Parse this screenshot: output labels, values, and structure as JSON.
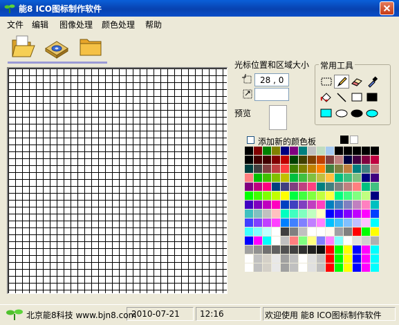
{
  "window": {
    "title": "能8 ICO图标制作软件"
  },
  "menu": [
    "文件",
    "编辑",
    "图像处理",
    "颜色处理",
    "帮助"
  ],
  "toolbar": {
    "icons": [
      "open-folder-icon",
      "disk-save-icon",
      "folder-icon"
    ]
  },
  "cursor_area": {
    "label": "光标位置和区域大小",
    "position_value": "28 , 0",
    "size_value": ""
  },
  "tools": {
    "title": "常用工具",
    "items": [
      "rect-select-icon",
      "pencil-icon",
      "eraser-icon",
      "eyedropper-icon",
      "fill-bucket-icon",
      "line-icon",
      "rectangle-outline-icon",
      "filled-rectangle-icon",
      "filled-rect-cyan-icon",
      "ellipse-outline-icon",
      "filled-ellipse-icon",
      "filled-ellipse-cyan-icon"
    ],
    "selected": "pencil-icon"
  },
  "preview": {
    "label": "预览"
  },
  "palette": {
    "add_label": "添加新的颜色板",
    "fg_color": "#000000",
    "bg_color": "#ffffff",
    "colors": [
      "#000000",
      "#800000",
      "#008000",
      "#808000",
      "#000080",
      "#800080",
      "#008080",
      "#c0c0c0",
      "#c0dcc0",
      "#a6caf0",
      "#000000",
      "#000000",
      "#000000",
      "#000000",
      "#000000",
      "#000000",
      "#400000",
      "#400000",
      "#800000",
      "#c00000",
      "#004000",
      "#404000",
      "#804000",
      "#c04000",
      "#804040",
      "#c08080",
      "#000040",
      "#400040",
      "#800040",
      "#c00040",
      "#004040",
      "#404040",
      "#804040",
      "#c04040",
      "#ff4040",
      "#408000",
      "#808000",
      "#c08000",
      "#ff8000",
      "#408040",
      "#808040",
      "#c08040",
      "#008080",
      "#408080",
      "#c08080",
      "#ff8080",
      "#00c000",
      "#40c000",
      "#80c000",
      "#c0c000",
      "#00c040",
      "#40c040",
      "#80c040",
      "#c0c040",
      "#ffc040",
      "#00c080",
      "#40c080",
      "#80c080",
      "#000080",
      "#400080",
      "#800080",
      "#c00080",
      "#ff0080",
      "#004080",
      "#404080",
      "#804080",
      "#c04080",
      "#ff4080",
      "#008080",
      "#408080",
      "#808080",
      "#c08080",
      "#ff8080",
      "#00c080",
      "#40c080",
      "#00ff00",
      "#40ff00",
      "#80ff00",
      "#c0ff00",
      "#ffff00",
      "#00ff40",
      "#40ff40",
      "#80ff40",
      "#c0ff40",
      "#ffff40",
      "#00ff80",
      "#40ff80",
      "#80ff80",
      "#c0ff80",
      "#000080",
      "#4000c0",
      "#8000c0",
      "#c000c0",
      "#ff00c0",
      "#0040c0",
      "#4040c0",
      "#8040c0",
      "#c040c0",
      "#ff40c0",
      "#0080c0",
      "#4080c0",
      "#8080c0",
      "#c080c0",
      "#ff80c0",
      "#00c0c0",
      "#40c0c0",
      "#80c0c0",
      "#c0c0c0",
      "#ffc0c0",
      "#00ffc0",
      "#40ffc0",
      "#80ffc0",
      "#c0ffc0",
      "#ffffc0",
      "#0000ff",
      "#4000ff",
      "#8000ff",
      "#c000ff",
      "#ff00ff",
      "#0040ff",
      "#4040ff",
      "#8040ff",
      "#c040ff",
      "#ff40ff",
      "#0080ff",
      "#4080ff",
      "#8080ff",
      "#c080ff",
      "#ff80ff",
      "#00c0ff",
      "#40c0ff",
      "#80c0ff",
      "#c0c0ff",
      "#ffc0ff",
      "#00ffff",
      "#40ffff",
      "#80ffff",
      "#c0ffff",
      "#ffffff",
      "#404040",
      "#808080",
      "#c0c0c0",
      "#ffffff",
      "#ffffff",
      "#fffbf0",
      "#a0a0a4",
      "#808080",
      "#ff0000",
      "#00ff00",
      "#ffff00",
      "#0000ff",
      "#ff00ff",
      "#00ffff",
      "#ffffff",
      "#c0c0c0",
      "#ff8080",
      "#80ff80",
      "#ffff80",
      "#8080ff",
      "#ff80ff",
      "#80ffff",
      "#ffffff",
      "#e0e0e0",
      "#d0d0d0",
      "#b0b0b0",
      "#a0a0a0",
      "#909090",
      "#707070",
      "#606060",
      "#505050",
      "#404040",
      "#303030",
      "#202020",
      "#101010",
      "#ff0000",
      "#00ff00",
      "#ffff00",
      "#0000ff",
      "#ff00ff",
      "#00ffff",
      "#ffffff",
      "#c0c0c0",
      "#d4d0c8",
      "#e8e8e8",
      "#a0a0a0",
      "#c0c0c0",
      "#ffffff",
      "#e0e0e0",
      "#c0c0c0",
      "#ff0000",
      "#00ff00",
      "#ffff00",
      "#0000ff",
      "#ff00ff",
      "#00ffff",
      "#ffffff",
      "#c0c0c0",
      "#d4d0c8",
      "#e8e8e8",
      "#a0a0a0",
      "#c0c0c0",
      "#ffffff",
      "#e0e0e0",
      "#c0c0c0",
      "#ff0000",
      "#00ff00",
      "#ffff00",
      "#0000ff",
      "#ff00ff",
      "#00ffff"
    ]
  },
  "status": {
    "company": "北京能8科技 www.bjn8.com",
    "date": "2010-07-21",
    "time": "12:16",
    "welcome": "欢迎使用 能8 ICO图标制作软件"
  }
}
